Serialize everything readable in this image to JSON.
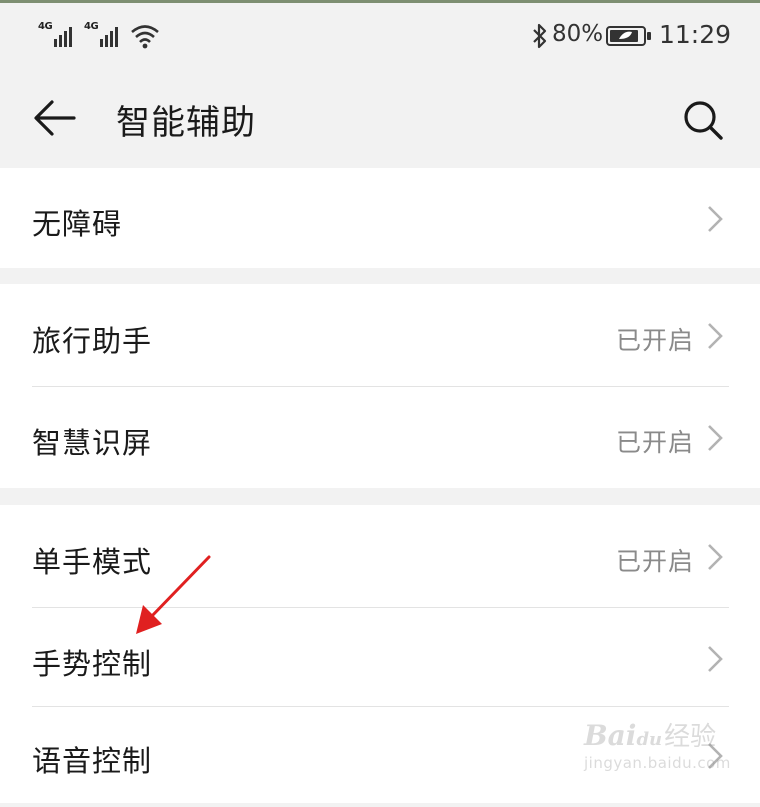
{
  "status_bar": {
    "signal_1_label": "4G",
    "signal_2_label": "4G",
    "bluetooth_icon": "bluetooth-icon",
    "battery_percent": "80%",
    "time": "11:29"
  },
  "header": {
    "title": "智能辅助"
  },
  "sections": [
    {
      "items": [
        {
          "label": "无障碍",
          "status": ""
        }
      ]
    },
    {
      "items": [
        {
          "label": "旅行助手",
          "status": "已开启"
        },
        {
          "label": "智慧识屏",
          "status": "已开启"
        }
      ]
    },
    {
      "items": [
        {
          "label": "单手模式",
          "status": "已开启"
        },
        {
          "label": "手势控制",
          "status": ""
        },
        {
          "label": "语音控制",
          "status": ""
        }
      ]
    }
  ],
  "watermark": {
    "brand": "Bai",
    "brand_suffix": "du",
    "cn": "经验",
    "url": "jingyan.baidu.com"
  },
  "colors": {
    "annotation_arrow": "#e02020",
    "background": "#f2f2f2",
    "status_text": "#8a8a8a"
  }
}
